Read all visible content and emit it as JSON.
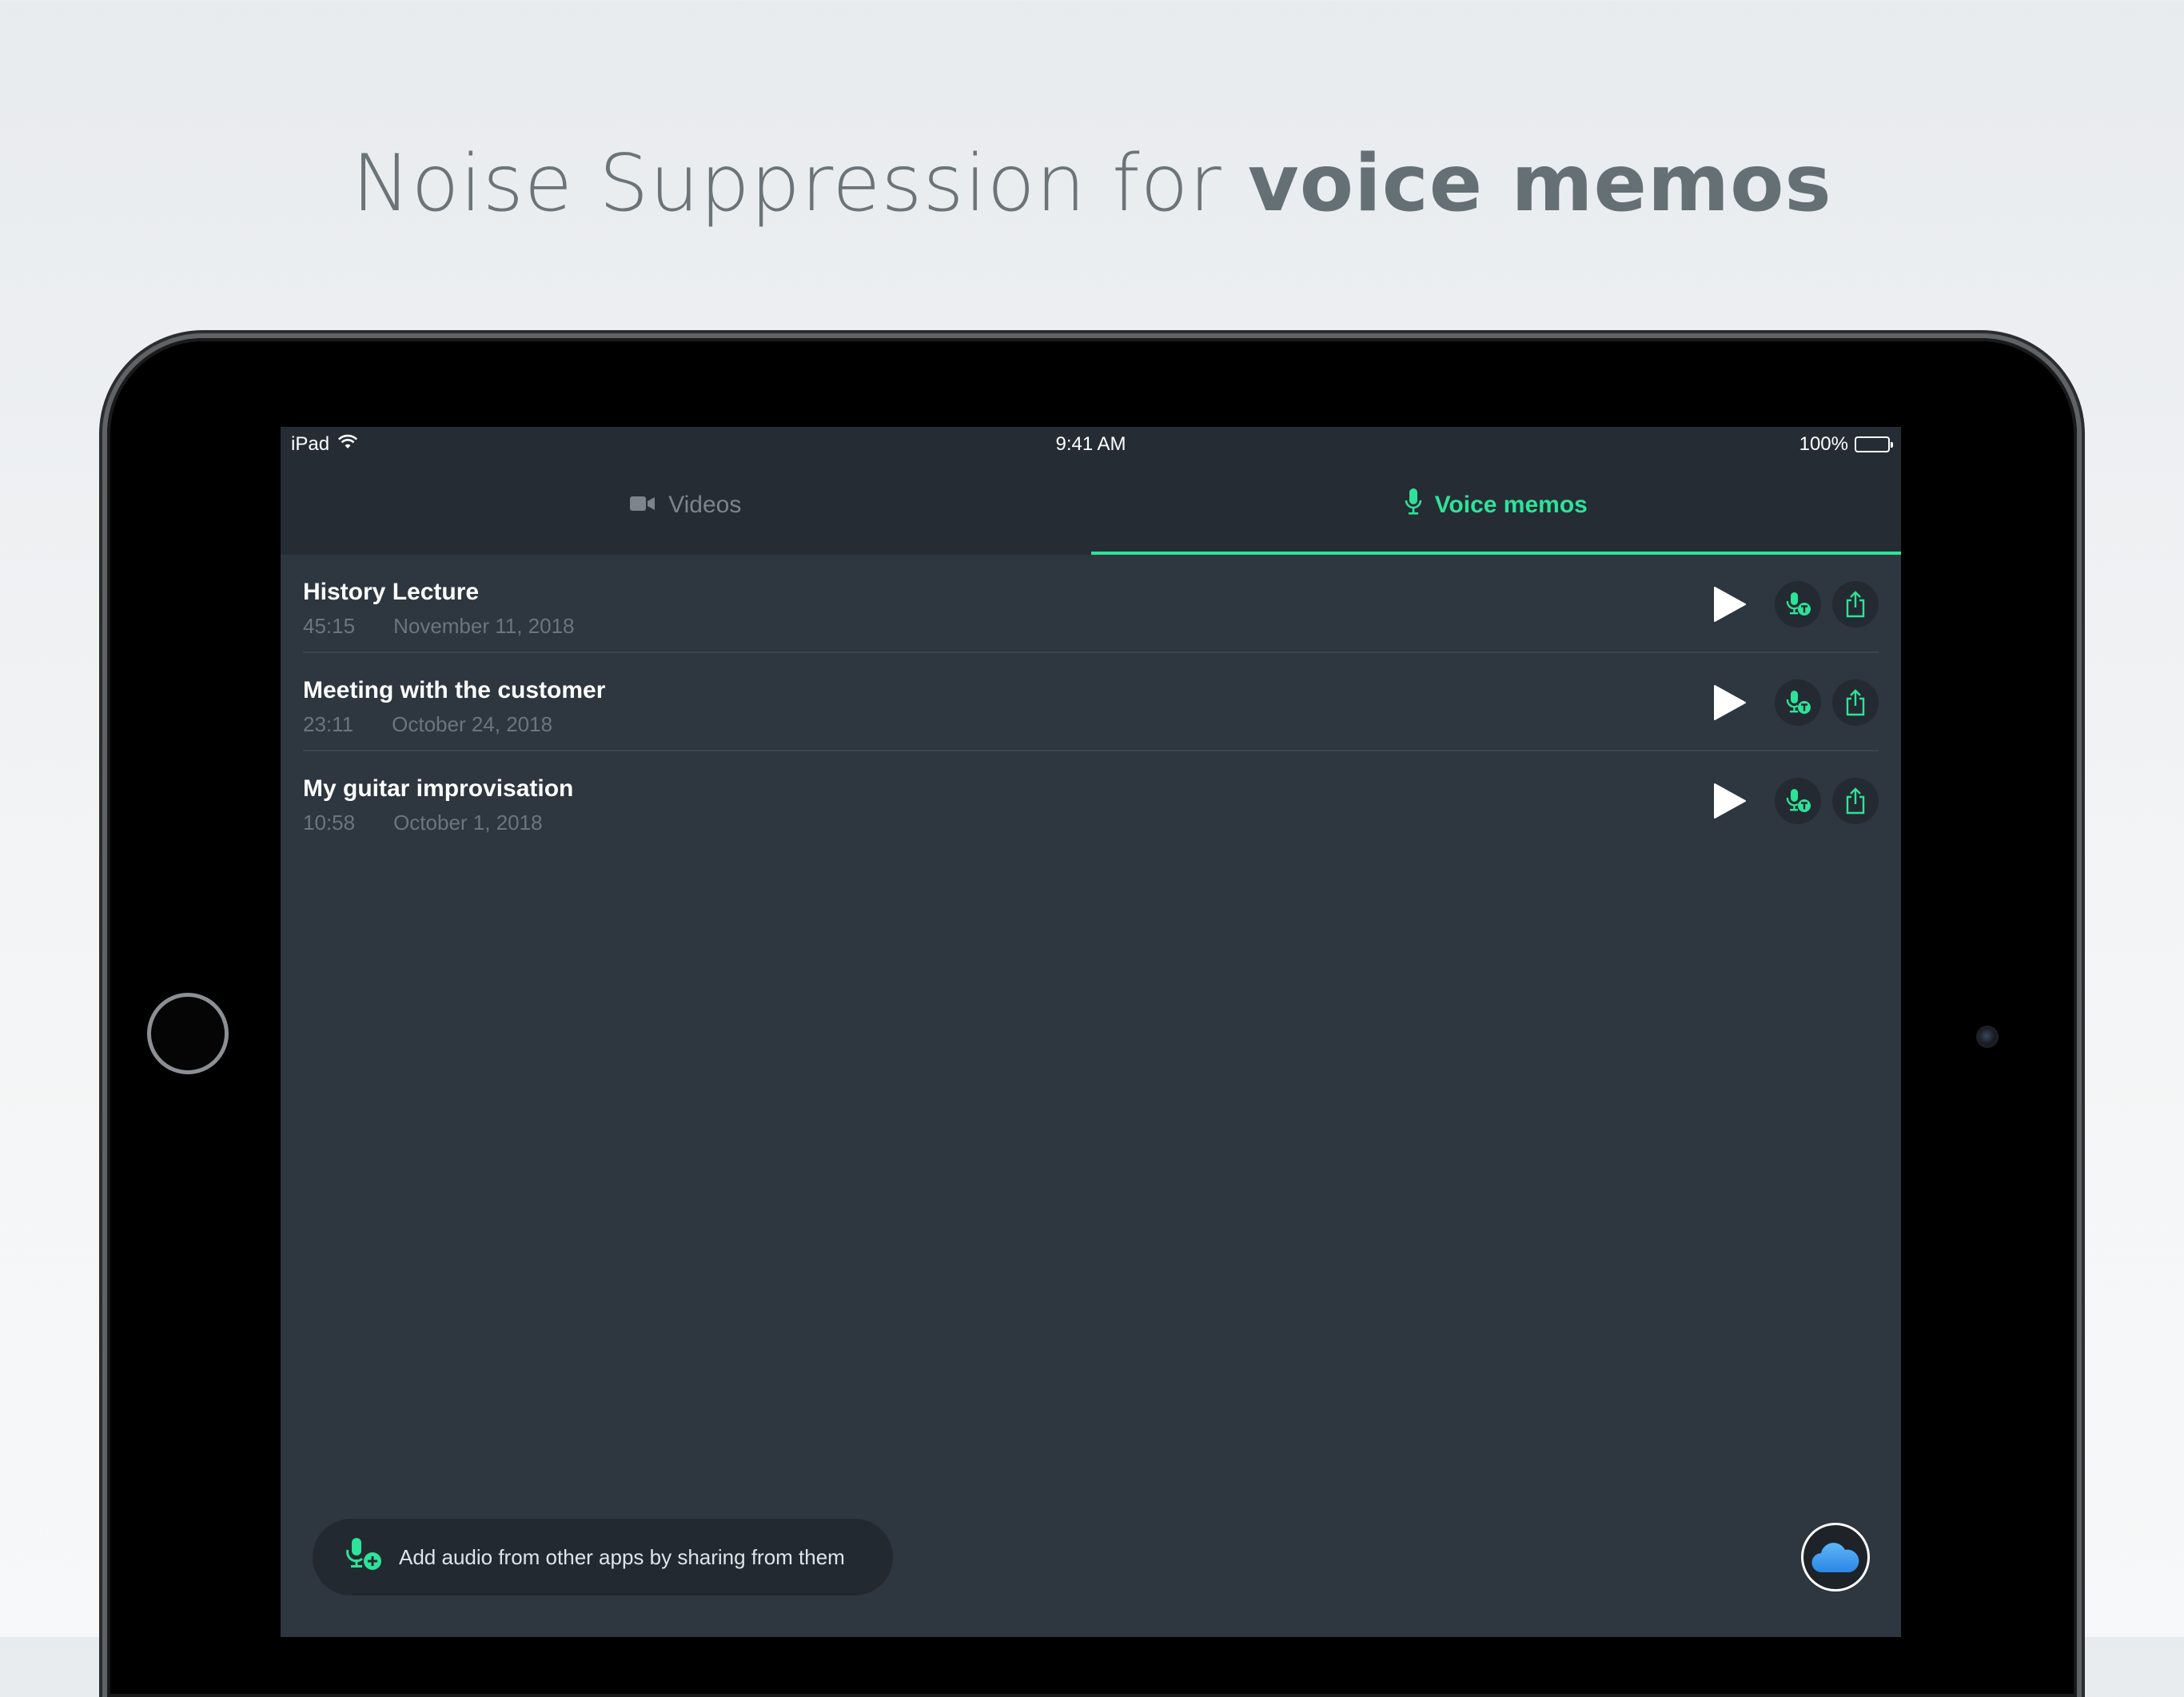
{
  "headline": {
    "light": "Noise Suppression for",
    "bold": "voice memos"
  },
  "status_bar": {
    "device": "iPad",
    "time": "9:41 AM",
    "battery": "100%"
  },
  "tabs": [
    {
      "label": "Videos",
      "icon": "video-camera-icon",
      "active": false
    },
    {
      "label": "Voice memos",
      "icon": "microphone-icon",
      "active": true
    }
  ],
  "recordings": [
    {
      "title": "History Lecture",
      "duration": "45:15",
      "date": "November 11, 2018"
    },
    {
      "title": "Meeting with the customer",
      "duration": "23:11",
      "date": "October 24, 2018"
    },
    {
      "title": "My guitar improvisation",
      "duration": "10:58",
      "date": "October 1, 2018"
    }
  ],
  "add_audio_hint": "Add audio from other apps by sharing from them",
  "colors": {
    "accent": "#2ee29a",
    "background": "#2e3640",
    "bar": "#262c33"
  }
}
